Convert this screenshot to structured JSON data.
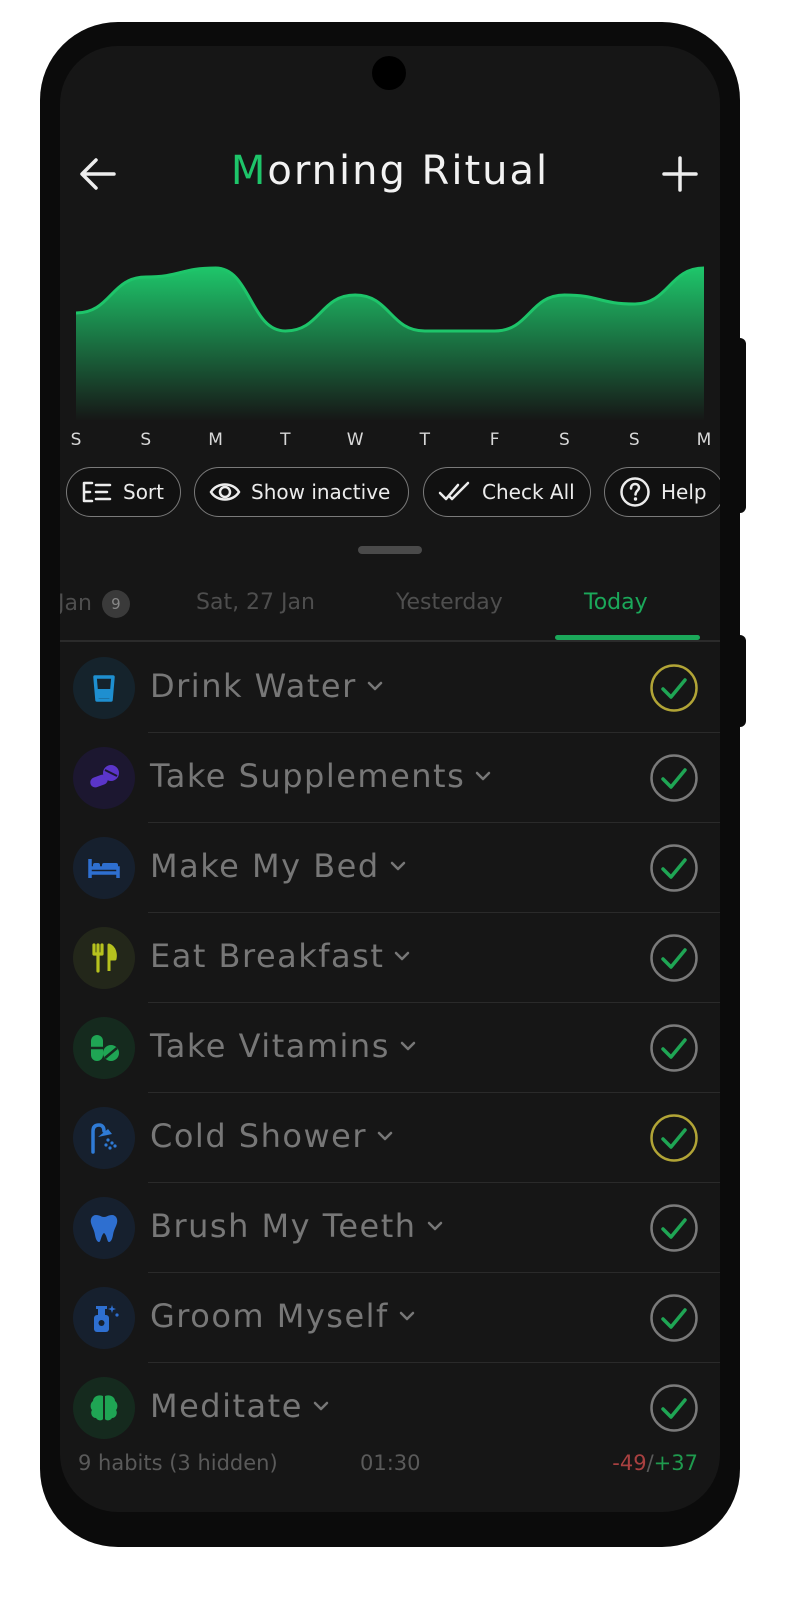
{
  "header": {
    "title_first": "M",
    "title_rest": "orning Ritual"
  },
  "chart_data": {
    "type": "area",
    "categories": [
      "S",
      "S",
      "M",
      "T",
      "W",
      "T",
      "F",
      "S",
      "S",
      "M"
    ],
    "values": [
      6,
      8,
      8.5,
      5,
      7,
      5,
      5,
      7,
      6.5,
      8.5
    ],
    "ylim": [
      0,
      10
    ],
    "color": "#1ec56a"
  },
  "chips": [
    {
      "label": "Sort",
      "icon": "sort-icon"
    },
    {
      "label": "Show inactive",
      "icon": "eye-icon"
    },
    {
      "label": "Check All",
      "icon": "double-check-icon"
    },
    {
      "label": "Help",
      "icon": "help-icon"
    }
  ],
  "tabs": [
    {
      "label": "Jan",
      "badge": "9"
    },
    {
      "label": "Sat, 27 Jan"
    },
    {
      "label": "Yesterday"
    },
    {
      "label": "Today"
    }
  ],
  "habits": [
    {
      "name": "Drink Water",
      "icon": "glass-icon",
      "color": "#1e8fd0",
      "bg": "#15232c",
      "check": "#b1a436"
    },
    {
      "name": "Take Supplements",
      "icon": "pills-icon",
      "color": "#5b35c9",
      "bg": "#1c1730",
      "check": "#7a7a7a"
    },
    {
      "name": "Make My Bed",
      "icon": "bed-icon",
      "color": "#2e6fd0",
      "bg": "#16202e",
      "check": "#7a7a7a"
    },
    {
      "name": "Eat Breakfast",
      "icon": "utensils-icon",
      "color": "#b6c21e",
      "bg": "#23271a",
      "check": "#7a7a7a"
    },
    {
      "name": "Take Vitamins",
      "icon": "capsule-icon",
      "color": "#1fa554",
      "bg": "#152a1e",
      "check": "#7a7a7a"
    },
    {
      "name": "Cold Shower",
      "icon": "shower-icon",
      "color": "#2f7bd6",
      "bg": "#16202e",
      "check": "#b1a436"
    },
    {
      "name": "Brush My Teeth",
      "icon": "tooth-icon",
      "color": "#2e6fd0",
      "bg": "#16202e",
      "check": "#7a7a7a"
    },
    {
      "name": "Groom Myself",
      "icon": "spray-icon",
      "color": "#2e6fd0",
      "bg": "#16202e",
      "check": "#7a7a7a"
    },
    {
      "name": "Meditate",
      "icon": "brain-icon",
      "color": "#1fa554",
      "bg": "#152a1e",
      "check": "#7a7a7a"
    }
  ],
  "footer": {
    "count": "9 habits (3 hidden)",
    "time": "01:30",
    "neg": "-49",
    "sep": "/",
    "pos": "+37"
  }
}
